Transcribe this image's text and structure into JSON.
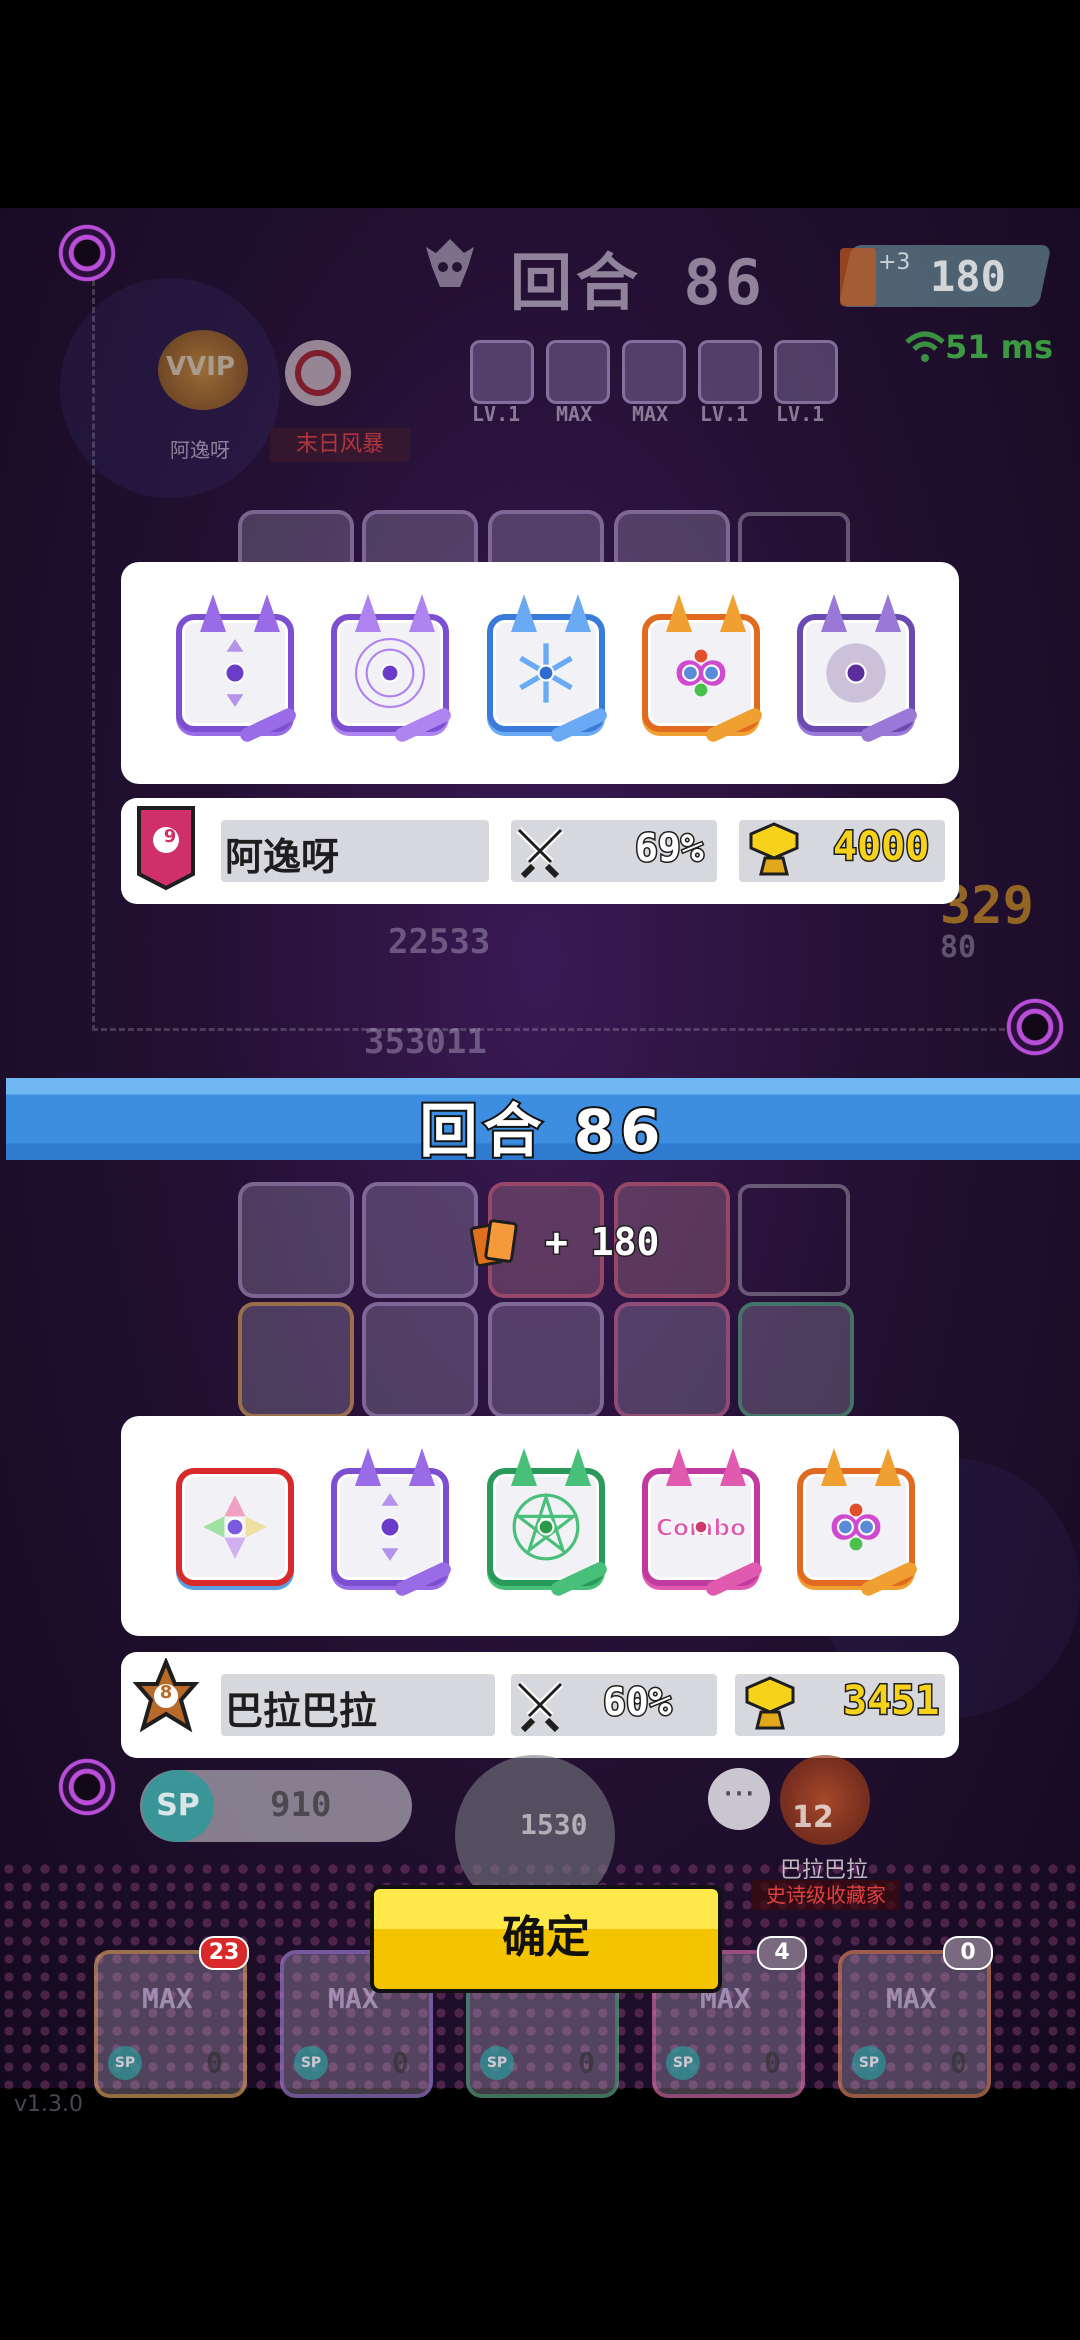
{
  "round": {
    "label": "回合",
    "number": "86"
  },
  "top_hud": {
    "round_text": "回合 86",
    "cards_value": "180",
    "cards_plus": "+3",
    "ping": "51 ms",
    "vip_label": "VVIP",
    "player_name": "阿逸呀",
    "mode_tag": "末日风暴",
    "mini_slots": [
      "LV.1",
      "MAX",
      "MAX",
      "LV.1",
      "LV.1"
    ],
    "ghost_numbers": [
      "22533",
      "353011",
      "329",
      "80"
    ]
  },
  "player1": {
    "rank": "9",
    "name": "阿逸呀",
    "win_rate": "69%",
    "gold": "4000",
    "dice": [
      "purple-arrow-die",
      "purple-rune-die",
      "blue-frost-die",
      "rainbow-infinity-die",
      "purple-shadow-die"
    ]
  },
  "round_banner": {
    "text": "回合   86"
  },
  "reward": {
    "text": "+ 180"
  },
  "player2": {
    "rank": "8",
    "name": "巴拉巴拉",
    "win_rate": "60%",
    "gold": "3451",
    "dice": [
      "rainbow-prism-die",
      "purple-arrow-die",
      "green-pentagram-die",
      "combo-die",
      "rainbow-infinity-die"
    ]
  },
  "bottom_hud": {
    "sp_label": "SP",
    "sp_value": "910",
    "summon_cost": "1530",
    "opponent_name": "巴拉巴拉",
    "opponent_level": "12",
    "opponent_tag": "史诗级收藏家",
    "chat_icon": "···",
    "confirm_label": "确定",
    "version": "v1.3.0",
    "deck": [
      {
        "label": "MAX",
        "badge": "23",
        "sp": "SP",
        "count": "0"
      },
      {
        "label": "MAX",
        "badge": "",
        "sp": "SP",
        "count": "0"
      },
      {
        "label": "",
        "badge": "",
        "sp": "SP",
        "count": "0"
      },
      {
        "label": "MAX",
        "badge": "4",
        "sp": "SP",
        "count": "0"
      },
      {
        "label": "MAX",
        "badge": "0",
        "sp": "SP",
        "count": "0"
      }
    ]
  },
  "colors": {
    "accent_blue": "#3d8ee0",
    "confirm_yellow": "#f5c400",
    "gold": "#f7d21a",
    "rank_pink": "#d0306a",
    "rank_bronze": "#b86a2a"
  }
}
